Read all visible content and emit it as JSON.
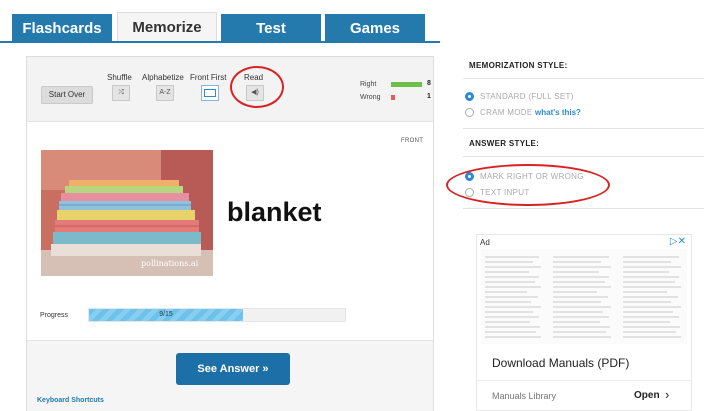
{
  "tabs": [
    {
      "label": "Flashcards"
    },
    {
      "label": "Memorize"
    },
    {
      "label": "Test"
    },
    {
      "label": "Games"
    }
  ],
  "toolbar": {
    "start_over": "Start Over",
    "shuffle": "Shuffle",
    "alphabetize": "Alphabetize",
    "front_first": "Front First",
    "read": "Read",
    "alphabetize_glyph": "A-Z"
  },
  "stats": {
    "right_label": "Right",
    "right_count": "8",
    "wrong_label": "Wrong",
    "wrong_count": "1",
    "right_color": "#6cc04a",
    "wrong_color": "#e35b5b"
  },
  "card": {
    "side_label": "FRONT",
    "word": "blanket",
    "image_watermark": "pollinations.ai"
  },
  "progress": {
    "label": "Progress",
    "text": "9/15",
    "fraction": 0.6
  },
  "see_answer": "See Answer »",
  "keyboard_shortcuts": "Keyboard Shortcuts",
  "sidebar": {
    "memorization_heading": "MEMORIZATION STYLE:",
    "standard_option": "STANDARD (FULL SET)",
    "cram_option": "CRAM MODE",
    "whats_this": "what's this?",
    "answer_heading": "ANSWER STYLE:",
    "mark_option": "MARK RIGHT OR WRONG",
    "text_input_option": "TEXT INPUT"
  },
  "ad": {
    "badge": "Ad",
    "title": "Download Manuals (PDF)",
    "source": "Manuals Library",
    "cta": "Open"
  },
  "colors": {
    "tab_blue": "#2479ad",
    "button_blue": "#1d6fa8",
    "accent": "#2d8ad0",
    "annotation_red": "#d92323"
  }
}
